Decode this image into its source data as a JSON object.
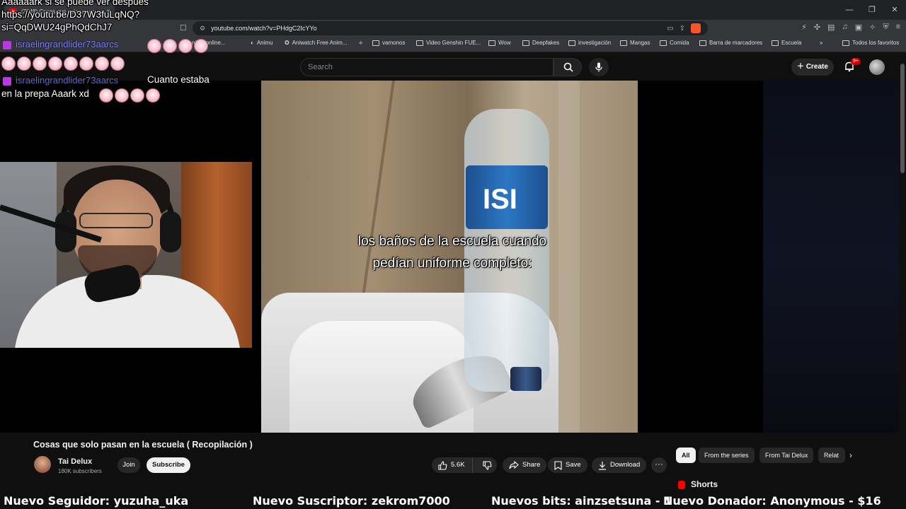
{
  "browser": {
    "tab_title": "(7048) Cosas que solo pasan en",
    "tab_close": "×",
    "window_controls": [
      "—",
      "❐",
      "✕"
    ],
    "url": "youtube.com/watch?v=PHdgC2IcYYo",
    "bookmarks": [
      {
        "label": "Animu",
        "type": "site"
      },
      {
        "label": "Aniwatch Free Anim...",
        "type": "site"
      },
      {
        "label": "vamonos",
        "type": "folder"
      },
      {
        "label": "Video Genshin FUE...",
        "type": "folder"
      },
      {
        "label": "Wow",
        "type": "folder"
      },
      {
        "label": "Deepfakes",
        "type": "folder"
      },
      {
        "label": "investigación",
        "type": "folder"
      },
      {
        "label": "Mangas",
        "type": "folder"
      },
      {
        "label": "Comida",
        "type": "folder"
      },
      {
        "label": "Barra de marcadores",
        "type": "folder"
      },
      {
        "label": "Escuela",
        "type": "folder"
      }
    ],
    "bookmarks_more": "»",
    "all_favorites": "Todos los favoritos",
    "partial_bookmark": "nime online..."
  },
  "youtube": {
    "search_placeholder": "Search",
    "create_label": "Create",
    "notification_count": "9+",
    "video_caption": "los baños de la escuela cuando pedían uniforme completo:",
    "bottle_brand": "ISI",
    "video_title": "Cosas que solo pasan en la escuela ( Recopilación )",
    "channel_name": "Tai Delux",
    "subscribers": "180K subscribers",
    "join_label": "Join",
    "subscribe_label": "Subscribe",
    "like_count": "5.6K",
    "share_label": "Share",
    "save_label": "Save",
    "download_label": "Download",
    "more_label": "···",
    "chips": [
      "All",
      "From the series",
      "From Tai Delux",
      "Relat"
    ],
    "chip_next": "›",
    "shorts_label": "Shorts"
  },
  "stream_overlay": {
    "line1": "Aaaaaark si se puede ver despues",
    "line2": "https://youtu.be/D37W3fuLqNQ?",
    "line3": "si=QqDWU24gPhQdChJ7",
    "chat_user": "israelingrandlider73aarcs",
    "chat_msg_part1": "Cuanto estaba",
    "chat_msg_part2": "en la prepa Aaark xd",
    "ticker": [
      "Nuevo Seguidor: yuzuha_uka",
      "Nuevo Suscriptor: zekrom7000",
      "Nuevos bits: ainzsetsuna - 1",
      "Nuevo Donador: Anonymous - $16"
    ]
  },
  "colors": {
    "yt_background": "#0f0f0f",
    "yt_red": "#ff0000",
    "chip_active": "#f1f1f1",
    "chat_name": "#7b7bff"
  }
}
